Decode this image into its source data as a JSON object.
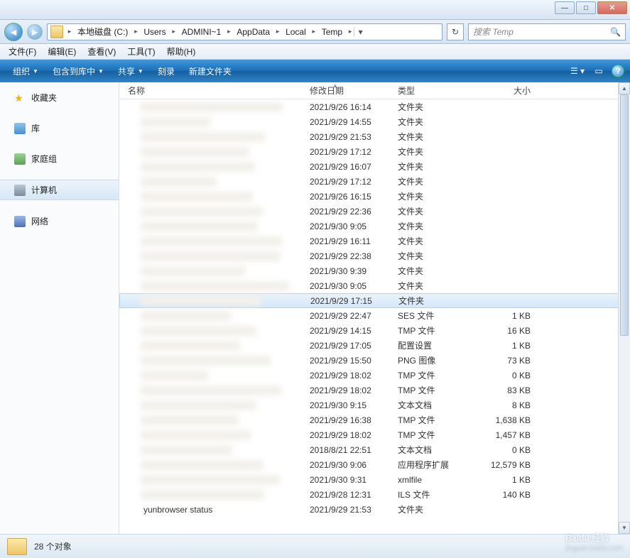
{
  "window": {
    "minimize": "—",
    "maximize": "□",
    "close": "✕"
  },
  "breadcrumbs": [
    "本地磁盘 (C:)",
    "Users",
    "ADMINI~1",
    "AppData",
    "Local",
    "Temp"
  ],
  "search": {
    "placeholder": "搜索 Temp"
  },
  "menu": {
    "file": "文件(F)",
    "edit": "编辑(E)",
    "view": "查看(V)",
    "tools": "工具(T)",
    "help": "帮助(H)"
  },
  "cmdbar": {
    "organize": "组织",
    "include": "包含到库中",
    "share": "共享",
    "burn": "刻录",
    "newfolder": "新建文件夹"
  },
  "sidebar": {
    "favorites": "收藏夹",
    "libraries": "库",
    "homegroup": "家庭组",
    "computer": "计算机",
    "network": "网络"
  },
  "columns": {
    "name": "名称",
    "date": "修改日期",
    "type": "类型",
    "size": "大小"
  },
  "rows": [
    {
      "date": "2021/9/26 16:14",
      "type": "文件夹",
      "size": ""
    },
    {
      "date": "2021/9/29 14:55",
      "type": "文件夹",
      "size": ""
    },
    {
      "date": "2021/9/29 21:53",
      "type": "文件夹",
      "size": ""
    },
    {
      "date": "2021/9/29 17:12",
      "type": "文件夹",
      "size": ""
    },
    {
      "date": "2021/9/29 16:07",
      "type": "文件夹",
      "size": ""
    },
    {
      "date": "2021/9/29 17:12",
      "type": "文件夹",
      "size": ""
    },
    {
      "date": "2021/9/26 16:15",
      "type": "文件夹",
      "size": ""
    },
    {
      "date": "2021/9/29 22:36",
      "type": "文件夹",
      "size": ""
    },
    {
      "date": "2021/9/30 9:05",
      "type": "文件夹",
      "size": ""
    },
    {
      "date": "2021/9/29 16:11",
      "type": "文件夹",
      "size": ""
    },
    {
      "date": "2021/9/29 22:38",
      "type": "文件夹",
      "size": ""
    },
    {
      "date": "2021/9/30 9:39",
      "type": "文件夹",
      "size": ""
    },
    {
      "date": "2021/9/30 9:05",
      "type": "文件夹",
      "size": ""
    },
    {
      "date": "2021/9/29 17:15",
      "type": "文件夹",
      "size": "",
      "selected": true
    },
    {
      "date": "2021/9/29 22:47",
      "type": "SES 文件",
      "size": "1 KB"
    },
    {
      "date": "2021/9/29 14:15",
      "type": "TMP 文件",
      "size": "16 KB"
    },
    {
      "date": "2021/9/29 17:05",
      "type": "配置设置",
      "size": "1 KB"
    },
    {
      "date": "2021/9/29 15:50",
      "type": "PNG 图像",
      "size": "73 KB"
    },
    {
      "date": "2021/9/29 18:02",
      "type": "TMP 文件",
      "size": "0 KB"
    },
    {
      "date": "2021/9/29 18:02",
      "type": "TMP 文件",
      "size": "83 KB"
    },
    {
      "date": "2021/9/30 9:15",
      "type": "文本文档",
      "size": "8 KB"
    },
    {
      "date": "2021/9/29 16:38",
      "type": "TMP 文件",
      "size": "1,638 KB"
    },
    {
      "date": "2021/9/29 18:02",
      "type": "TMP 文件",
      "size": "1,457 KB"
    },
    {
      "date": "2018/8/21 22:51",
      "type": "文本文档",
      "size": "0 KB"
    },
    {
      "date": "2021/9/30 9:06",
      "type": "应用程序扩展",
      "size": "12,579 KB"
    },
    {
      "date": "2021/9/30 9:31",
      "type": "xmlfile",
      "size": "1 KB"
    },
    {
      "date": "2021/9/28 12:31",
      "type": "ILS 文件",
      "size": "140 KB"
    },
    {
      "date": "2021/9/29 21:53",
      "type": "文件夹",
      "size": "",
      "name": "yunbrowser status"
    }
  ],
  "status": {
    "count": "28 个对象"
  },
  "watermark": {
    "brand": "Baidu 经验",
    "url": "jingyan.baidu.com"
  }
}
